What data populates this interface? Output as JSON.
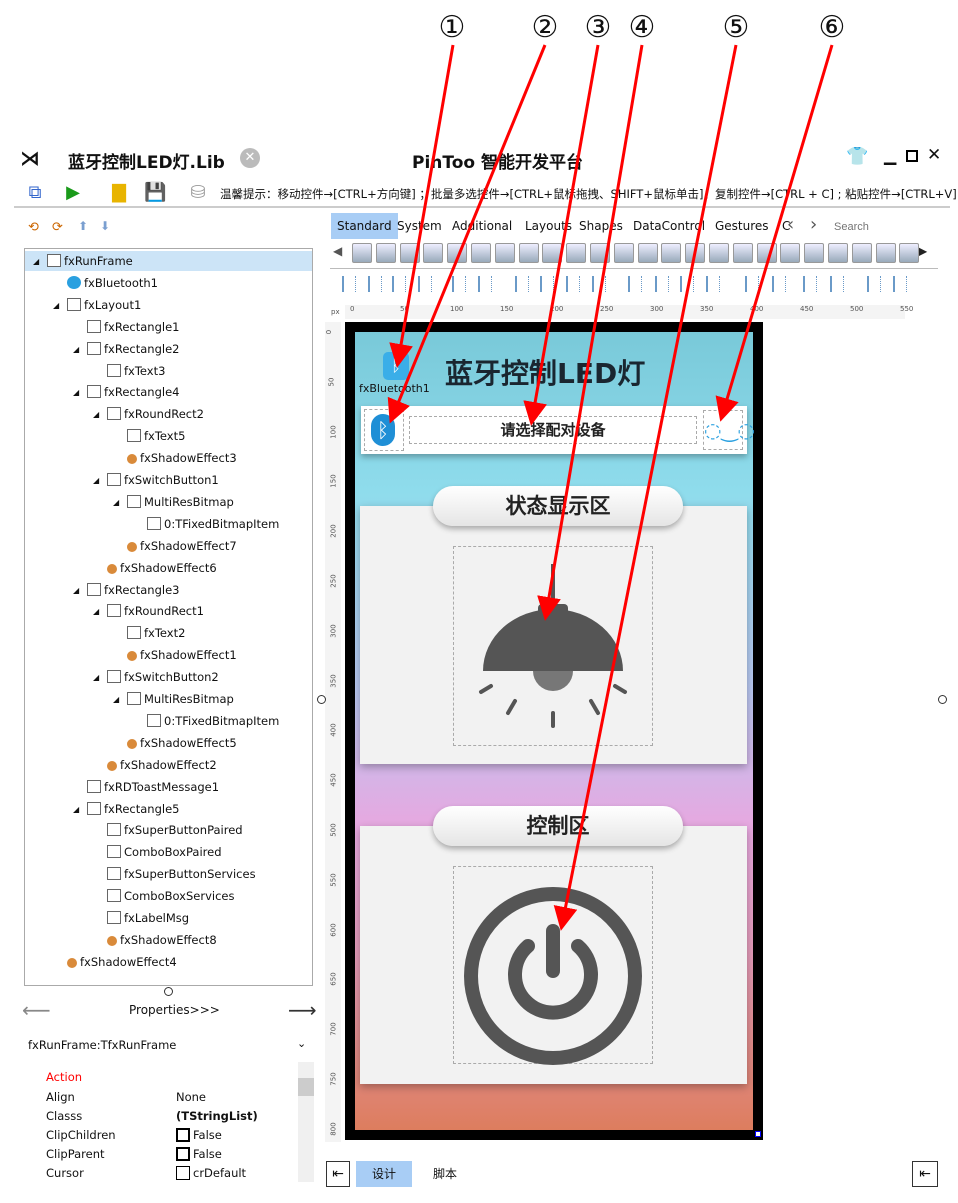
{
  "annotations": [
    "①",
    "②",
    "③",
    "④",
    "⑤",
    "⑥"
  ],
  "titlebar": {
    "file_tab": "蓝牙控制LED灯.Lib",
    "app_title": "PinToo 智能开发平台"
  },
  "toolbar": {
    "hint": "温馨提示：移动控件→[CTRL+方向键] ；批量多选控件→[CTRL+鼠标拖拽、SHIFT+鼠标单击]；复制控件→[CTRL + C] ; 粘贴控件→[CTRL+V]"
  },
  "tree": [
    {
      "label": "fxRunFrame",
      "depth": 0,
      "expanded": true,
      "selected": true
    },
    {
      "label": "fxBluetooth1",
      "depth": 1
    },
    {
      "label": "fxLayout1",
      "depth": 1,
      "expanded": true
    },
    {
      "label": "fxRectangle1",
      "depth": 2
    },
    {
      "label": "fxRectangle2",
      "depth": 2,
      "expanded": true
    },
    {
      "label": "fxText3",
      "depth": 3
    },
    {
      "label": "fxRectangle4",
      "depth": 2,
      "expanded": true
    },
    {
      "label": "fxRoundRect2",
      "depth": 3,
      "expanded": true
    },
    {
      "label": "fxText5",
      "depth": 4
    },
    {
      "label": "fxShadowEffect3",
      "depth": 4
    },
    {
      "label": "fxSwitchButton1",
      "depth": 3,
      "expanded": true
    },
    {
      "label": "MultiResBitmap",
      "depth": 4,
      "expanded": true
    },
    {
      "label": "0:TFixedBitmapItem",
      "depth": 5
    },
    {
      "label": "fxShadowEffect7",
      "depth": 4
    },
    {
      "label": "fxShadowEffect6",
      "depth": 3
    },
    {
      "label": "fxRectangle3",
      "depth": 2,
      "expanded": true
    },
    {
      "label": "fxRoundRect1",
      "depth": 3,
      "expanded": true
    },
    {
      "label": "fxText2",
      "depth": 4
    },
    {
      "label": "fxShadowEffect1",
      "depth": 4
    },
    {
      "label": "fxSwitchButton2",
      "depth": 3,
      "expanded": true
    },
    {
      "label": "MultiResBitmap",
      "depth": 4,
      "expanded": true
    },
    {
      "label": "0:TFixedBitmapItem",
      "depth": 5
    },
    {
      "label": "fxShadowEffect5",
      "depth": 4
    },
    {
      "label": "fxShadowEffect2",
      "depth": 3
    },
    {
      "label": "fxRDToastMessage1",
      "depth": 2
    },
    {
      "label": "fxRectangle5",
      "depth": 2,
      "expanded": true
    },
    {
      "label": "fxSuperButtonPaired",
      "depth": 3
    },
    {
      "label": "ComboBoxPaired",
      "depth": 3
    },
    {
      "label": "fxSuperButtonServices",
      "depth": 3
    },
    {
      "label": "ComboBoxServices",
      "depth": 3
    },
    {
      "label": "fxLabelMsg",
      "depth": 3
    },
    {
      "label": "fxShadowEffect8",
      "depth": 3
    },
    {
      "label": "fxShadowEffect4",
      "depth": 1
    }
  ],
  "properties": {
    "nav_label": "Properties>>>",
    "object": "fxRunFrame:TfxRunFrame",
    "category": "Action",
    "rows": [
      {
        "name": "Align",
        "value": "None"
      },
      {
        "name": "Classs",
        "value": "(TStringList)"
      },
      {
        "name": "ClipChildren",
        "value": "False"
      },
      {
        "name": "ClipParent",
        "value": "False"
      },
      {
        "name": "Cursor",
        "value": "crDefault"
      }
    ]
  },
  "palette": {
    "tabs": [
      "Standard",
      "System",
      "Additional",
      "Layouts",
      "Shapes",
      "DataControl",
      "Gestures",
      "C"
    ],
    "active": "Standard",
    "search_placeholder": "Search"
  },
  "ruler": {
    "unit": "px",
    "h_ticks": [
      "0",
      "50",
      "100",
      "150",
      "200",
      "250",
      "300",
      "350",
      "400",
      "450",
      "500",
      "550"
    ],
    "v_ticks": [
      "0",
      "50",
      "100",
      "150",
      "200",
      "250",
      "300",
      "350",
      "400",
      "450",
      "500",
      "550",
      "600",
      "650",
      "700",
      "750",
      "800"
    ]
  },
  "design": {
    "title": "蓝牙控制LED灯",
    "bluetooth_label": "fxBluetooth1",
    "pair_prompt": "请选择配对设备",
    "status_header": "状态显示区",
    "control_header": "控制区"
  },
  "bottom_tabs": [
    "设计",
    "脚本"
  ],
  "colors": {
    "accent_tab": "#a8cdf5",
    "annotation_arrow": "#ff0000",
    "category": "#ff0000"
  }
}
